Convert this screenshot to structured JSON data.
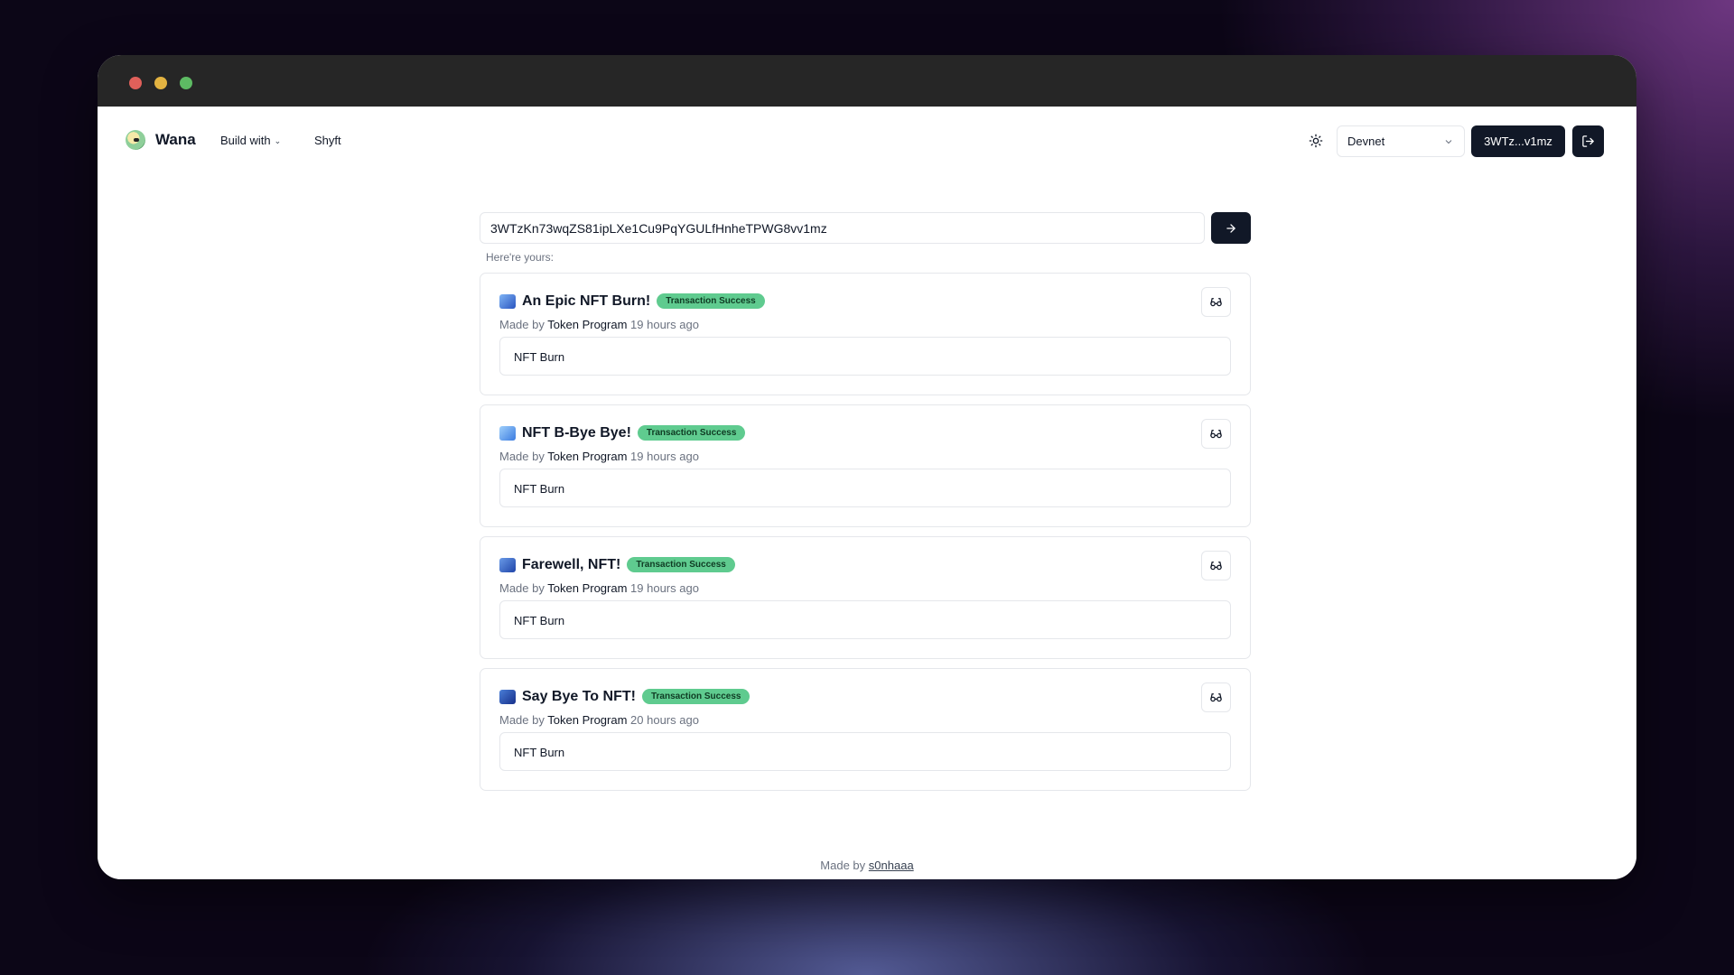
{
  "app": {
    "brand": "Wana",
    "nav": {
      "build_with": "Build with",
      "shyft": "Shyft"
    },
    "network": "Devnet",
    "wallet": "3WTz...v1mz"
  },
  "search": {
    "value": "3WTzKn73wqZS81ipLXe1Cu9PqYGULfHnheTPWG8vv1mz",
    "hint": "Here're yours:"
  },
  "cards": [
    {
      "title": "An Epic NFT Burn!",
      "badge": "Transaction Success",
      "made_by": "Made by",
      "author": "Token Program",
      "time": "19 hours ago",
      "body": "NFT Burn",
      "icon_color": "#3b6fd8"
    },
    {
      "title": "NFT B-Bye Bye!",
      "badge": "Transaction Success",
      "made_by": "Made by",
      "author": "Token Program",
      "time": "19 hours ago",
      "body": "NFT Burn",
      "icon_color": "#4a8fe8"
    },
    {
      "title": "Farewell, NFT!",
      "badge": "Transaction Success",
      "made_by": "Made by",
      "author": "Token Program",
      "time": "19 hours ago",
      "body": "NFT Burn",
      "icon_color": "#2f5fc4"
    },
    {
      "title": "Say Bye To NFT!",
      "badge": "Transaction Success",
      "made_by": "Made by",
      "author": "Token Program",
      "time": "20 hours ago",
      "body": "NFT Burn",
      "icon_color": "#2450b0"
    }
  ],
  "footer": {
    "text": "Made by",
    "link": "s0nhaaa"
  },
  "icons": {
    "theme": "sun-icon",
    "select": "chevron-down-icon",
    "logout": "logout-icon",
    "go": "arrow-right-icon",
    "view": "glasses-icon"
  },
  "colors": {
    "primary": "#111827",
    "badge": "#5fcb8f",
    "border": "#e5e7eb"
  }
}
